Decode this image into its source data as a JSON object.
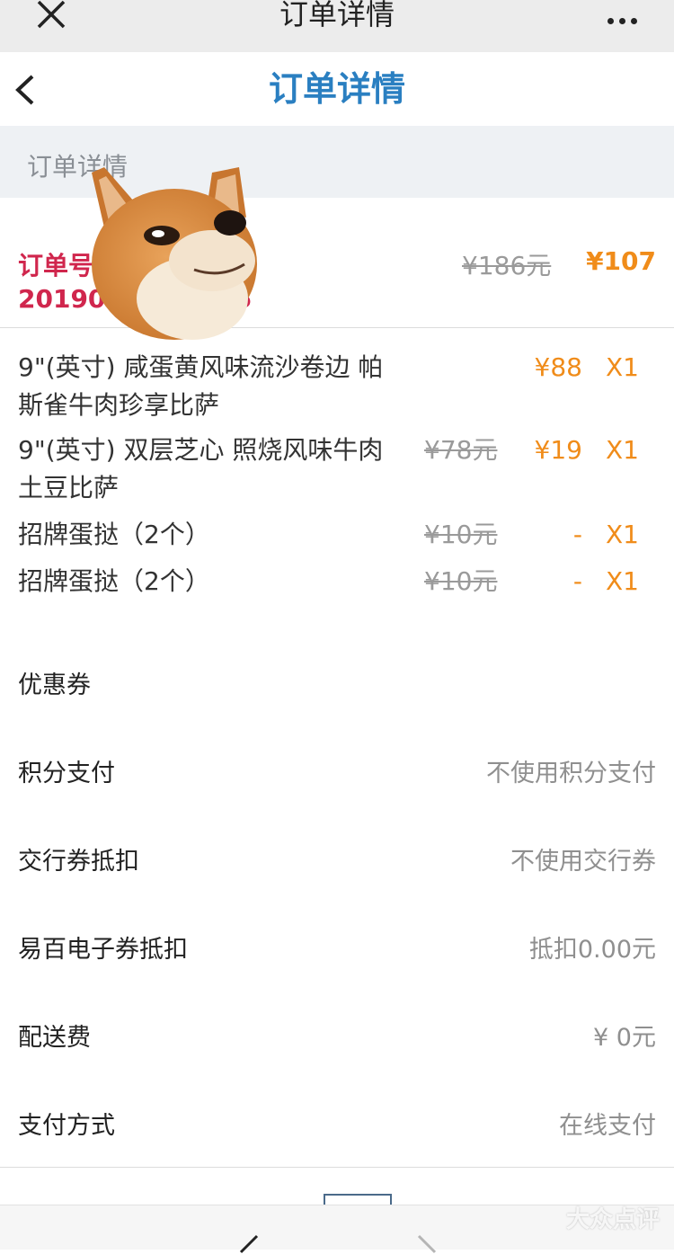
{
  "wechat_bar": {
    "title": "订单详情",
    "close_icon": "close-icon",
    "more_icon": "more-dots-icon"
  },
  "nav": {
    "title": "订单详情",
    "back_icon": "back-arrow-icon"
  },
  "section": {
    "header": "订单详情"
  },
  "order": {
    "label": "订单号",
    "number_prefix": "201909",
    "number_suffix": "5",
    "original_total": "¥186元",
    "total": "¥107"
  },
  "items": [
    {
      "name": "9\"(英寸) 咸蛋黄风味流沙卷边 帕斯雀牛肉珍享比萨",
      "original": "",
      "price": "¥88",
      "qty": "X1"
    },
    {
      "name": "9\"(英寸) 双层芝心 照烧风味牛肉土豆比萨",
      "original": "¥78元",
      "price": "¥19",
      "qty": "X1"
    },
    {
      "name": "招牌蛋挞（2个）",
      "original": "¥10元",
      "price": "-",
      "qty": "X1"
    },
    {
      "name": "招牌蛋挞（2个）",
      "original": "¥10元",
      "price": "-",
      "qty": "X1"
    }
  ],
  "rows": [
    {
      "label": "优惠券",
      "value": ""
    },
    {
      "label": "积分支付",
      "value": "不使用积分支付"
    },
    {
      "label": "交行券抵扣",
      "value": "不使用交行券"
    },
    {
      "label": "易百电子券抵扣",
      "value": "抵扣0.00元"
    },
    {
      "label": "配送费",
      "value": "¥ 0元"
    },
    {
      "label": "支付方式",
      "value": "在线支付"
    }
  ],
  "watermark": "大众点评",
  "colors": {
    "accent_blue": "#2a7fc1",
    "order_red": "#d0264d",
    "price_orange": "#f08c1a"
  }
}
